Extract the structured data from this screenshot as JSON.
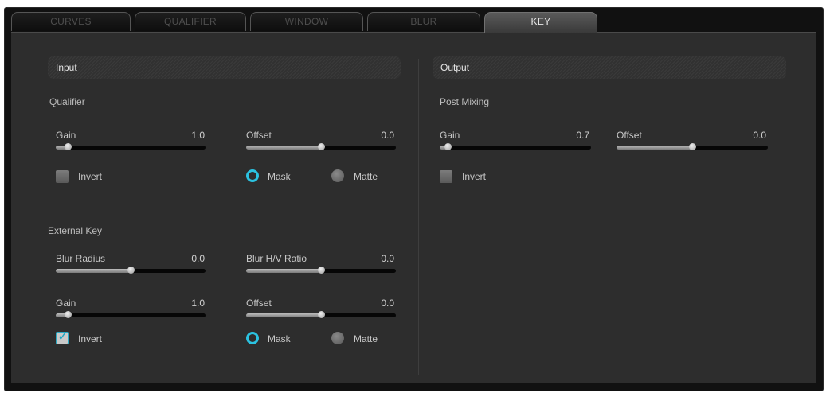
{
  "tabs": [
    "CURVES",
    "QUALIFIER",
    "WINDOW",
    "BLUR",
    "KEY"
  ],
  "active_tab": "KEY",
  "input": {
    "header": "Input",
    "qualifier": {
      "label": "Qualifier",
      "gain": {
        "label": "Gain",
        "value": "1.0",
        "level": 0.08
      },
      "offset": {
        "label": "Offset",
        "value": "0.0",
        "level": 0.5
      },
      "invert": {
        "label": "Invert",
        "checked": false
      },
      "mask": {
        "label": "Mask",
        "selected": true
      },
      "matte": {
        "label": "Matte",
        "selected": false
      }
    },
    "external_key": {
      "label": "External Key",
      "blur_radius": {
        "label": "Blur Radius",
        "value": "0.0",
        "level": 0.5
      },
      "blur_ratio": {
        "label": "Blur H/V Ratio",
        "value": "0.0",
        "level": 0.5
      },
      "gain": {
        "label": "Gain",
        "value": "1.0",
        "level": 0.08
      },
      "offset": {
        "label": "Offset",
        "value": "0.0",
        "level": 0.5
      },
      "invert": {
        "label": "Invert",
        "checked": true
      },
      "mask": {
        "label": "Mask",
        "selected": true
      },
      "matte": {
        "label": "Matte",
        "selected": false
      }
    }
  },
  "output": {
    "header": "Output",
    "post_mixing": {
      "label": "Post Mixing",
      "gain": {
        "label": "Gain",
        "value": "0.7",
        "level": 0.05
      },
      "offset": {
        "label": "Offset",
        "value": "0.0",
        "level": 0.5
      },
      "invert": {
        "label": "Invert",
        "checked": false
      }
    }
  },
  "colors": {
    "accent": "#2bc2e0",
    "panel": "#2d2d2d"
  }
}
